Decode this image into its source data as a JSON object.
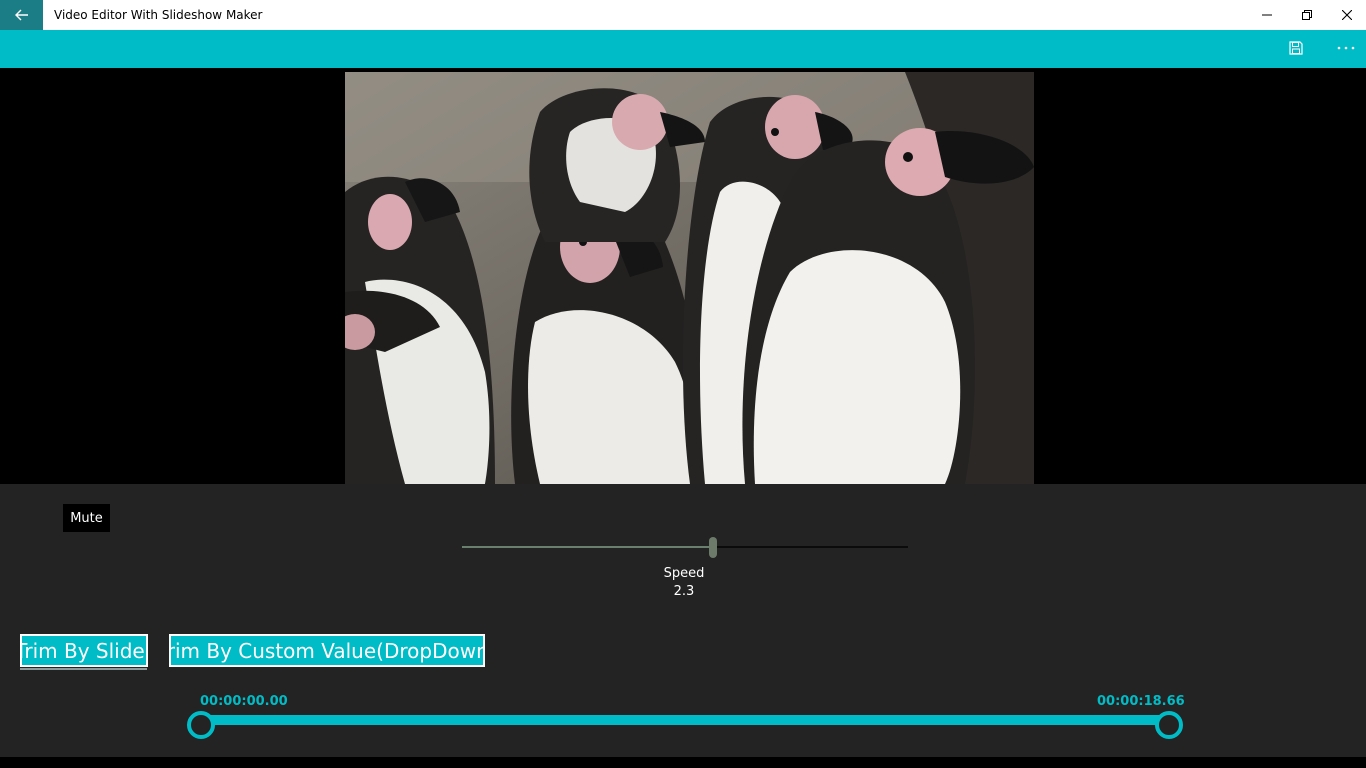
{
  "window": {
    "title": "Video Editor With Slideshow Maker",
    "back_icon": "back-arrow-icon",
    "controls": [
      "minimize-icon",
      "restore-icon",
      "close-icon"
    ]
  },
  "command_bar": {
    "items": [
      "save-icon",
      "more-options-icon"
    ],
    "color": "#00bcc6"
  },
  "video": {
    "scene": "penguins"
  },
  "audio": {
    "mute_label": "Mute"
  },
  "speed": {
    "label": "Speed",
    "value": "2.3",
    "fraction": 0.57
  },
  "trim": {
    "slider_button_label": "Trim By Slider",
    "custom_button_label": "Trim By Custom Value(DropDown)",
    "start_time": "00:00:00.00",
    "end_time": "00:00:18.66"
  },
  "colors": {
    "accent": "#00bcc6",
    "back_button": "#1b7d86",
    "panel_bg": "#232323"
  }
}
